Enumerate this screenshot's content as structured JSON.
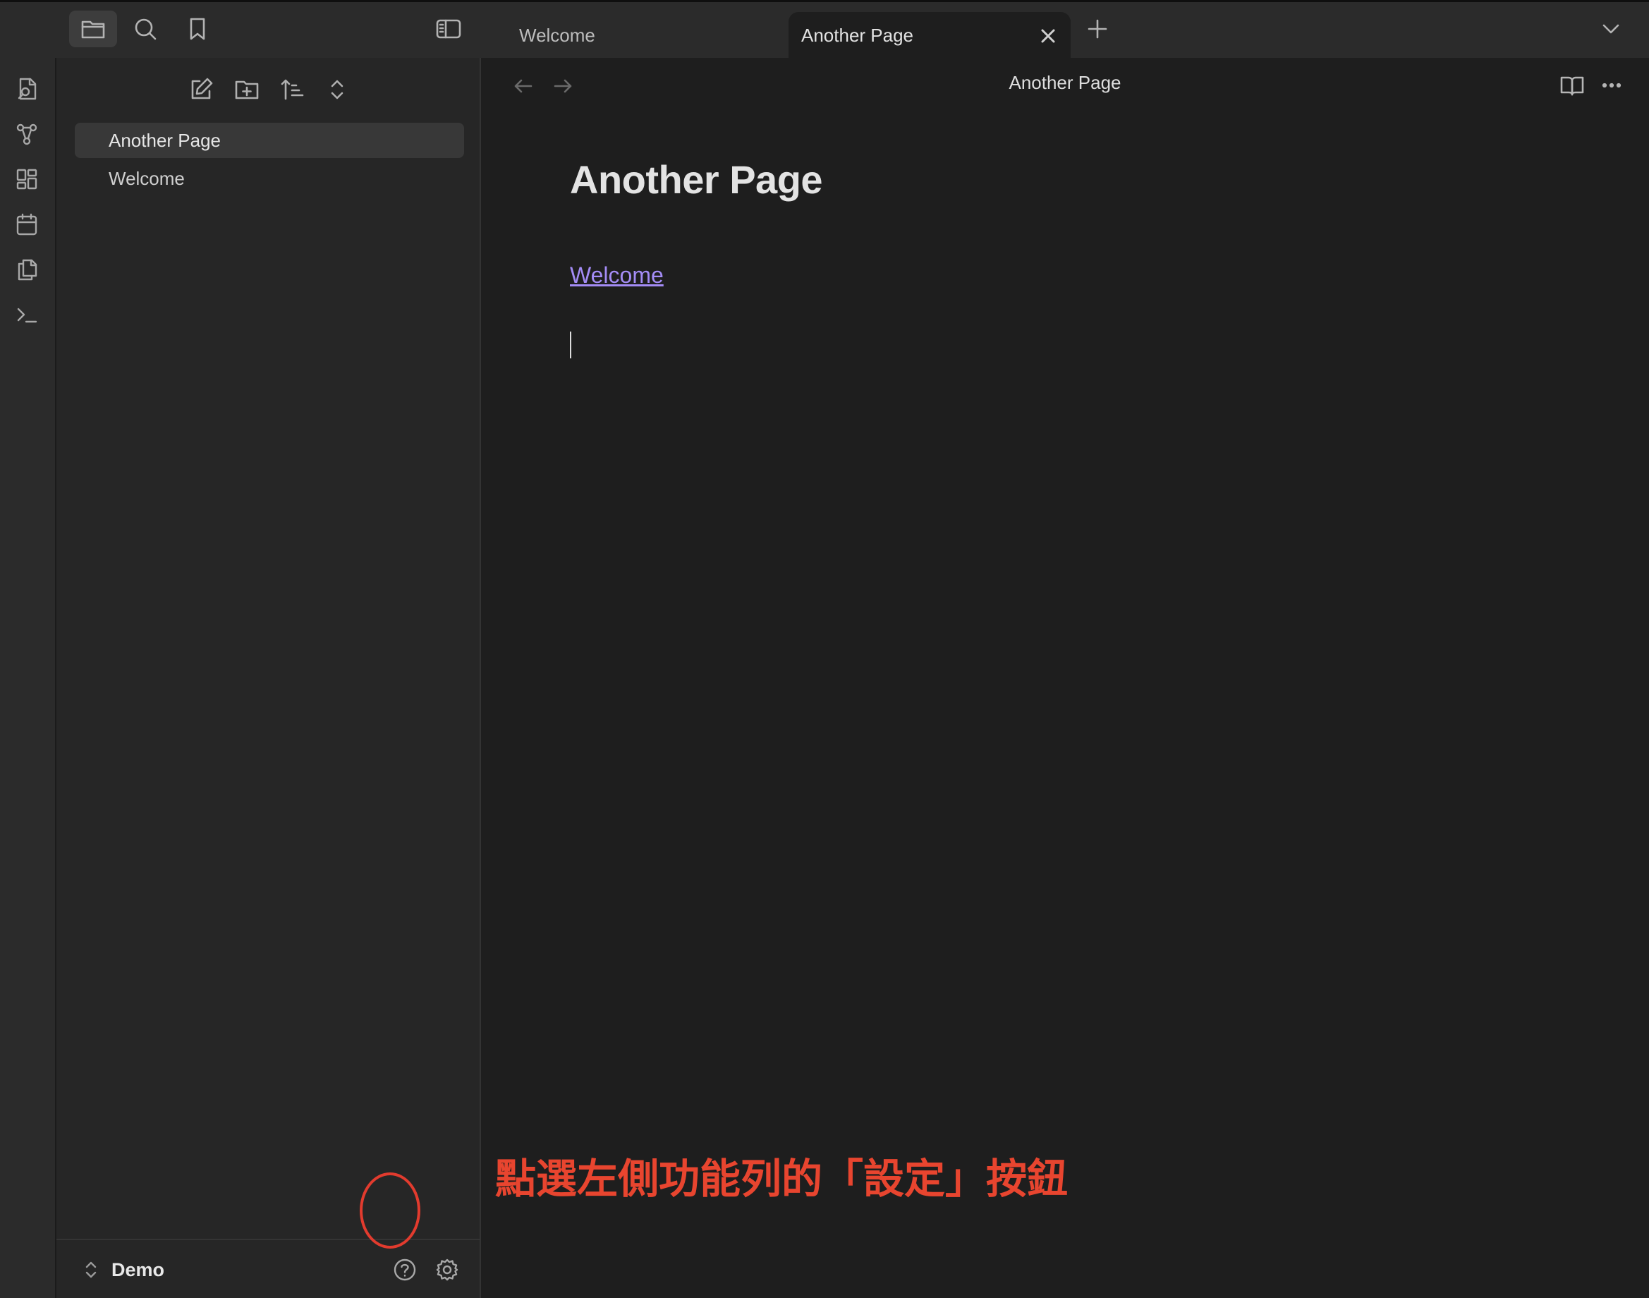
{
  "topbar": {
    "tabs": [
      {
        "label": "Welcome",
        "active": false
      },
      {
        "label": "Another Page",
        "active": true
      }
    ]
  },
  "icons": {
    "top": [
      "folder-icon",
      "search-icon",
      "bookmark-icon",
      "sidebar-toggle-icon",
      "close-icon",
      "plus-icon",
      "chevron-down-icon"
    ],
    "ribbon": [
      "quick-switcher-icon",
      "graph-view-icon",
      "canvas-icon",
      "daily-note-icon",
      "templates-icon",
      "command-palette-icon"
    ],
    "explorer_toolbar": [
      "new-note-icon",
      "new-folder-icon",
      "sort-icon",
      "collapse-icon"
    ],
    "editor": [
      "arrow-left-icon",
      "arrow-right-icon",
      "reading-view-icon",
      "more-options-icon"
    ],
    "footer": [
      "vault-switch-icon",
      "help-icon",
      "gear-icon"
    ]
  },
  "sidebar": {
    "files": [
      {
        "label": "Another Page",
        "active": true
      },
      {
        "label": "Welcome",
        "active": false
      }
    ],
    "vault_name": "Demo"
  },
  "editor": {
    "view_title": "Another Page",
    "heading": "Another Page",
    "link_text": "Welcome"
  },
  "annotation": {
    "text": "點選左側功能列的「設定」按鈕",
    "color": "#e8452f"
  },
  "colors": {
    "accent_link": "#a48cf6",
    "highlight": "#e23b2e"
  }
}
